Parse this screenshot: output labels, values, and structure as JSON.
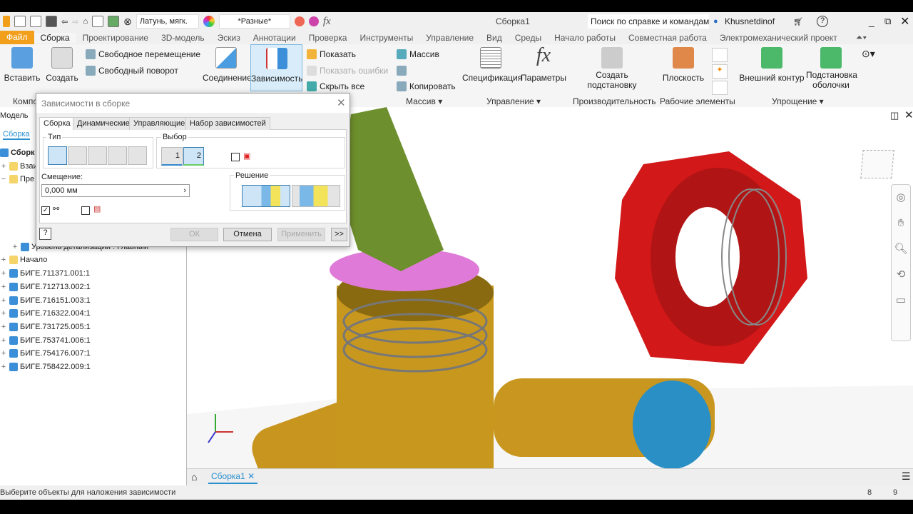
{
  "title_bar": {
    "document": "Сборка1",
    "search_placeholder": "Поиск по справке и командам.",
    "user": "Khusnetdinof",
    "material": "Латунь, мягк.",
    "appearance": "*Разные*",
    "fx": "fx"
  },
  "tabs": [
    "Файл",
    "Сборка",
    "Проектирование",
    "3D-модель",
    "Эскиз",
    "Аннотации",
    "Проверка",
    "Инструменты",
    "Управление",
    "Вид",
    "Среды",
    "Начало работы",
    "Совместная работа",
    "Электромеханический проект"
  ],
  "ribbon": {
    "insert": "Вставить",
    "create": "Создать",
    "group_component": "Компо",
    "free_move": "Свободное перемещение",
    "free_rotate": "Свободный поворот",
    "joint": "Соединение",
    "constraint": "Зависимость",
    "show": "Показать",
    "show_errors": "Показать ошибки",
    "hide_all": "Скрыть все",
    "pattern": "Массив",
    "copy": "Копировать",
    "group_pattern": "Массив ▾",
    "bom": "Спецификация",
    "params": "Параметры",
    "group_manage": "Управление ▾",
    "substitute1": "Создать",
    "substitute2": "подстановку",
    "group_productivity": "Производительность",
    "plane": "Плоскость",
    "group_work": "Рабочие элементы",
    "shrinkwrap": "Внешний контур",
    "shell1": "Подстановка",
    "shell2": "оболочки",
    "group_simplify": "Упрощение ▾"
  },
  "browser": {
    "tab_model": "Модель",
    "tab_assembly": "Сборка",
    "root": "Сборк",
    "items": [
      "Взаи",
      "Пре",
      "Уровень детализации : Главный",
      "Начало",
      "БИГЕ.711371.001:1",
      "БИГЕ.712713.002:1",
      "БИГЕ.716151.003:1",
      "БИГЕ.716322.004:1",
      "БИГЕ.731725.005:1",
      "БИГЕ.753741.006:1",
      "БИГЕ.754176.007:1",
      "БИГЕ.758422.009:1"
    ]
  },
  "dialog": {
    "title": "Зависимости в сборке",
    "tabs": [
      "Сборка",
      "Динамические",
      "Управляющие",
      "Набор зависимостей"
    ],
    "type_label": "Тип",
    "selection_label": "Выбор",
    "sel1": "1",
    "sel2": "2",
    "offset_label": "Смещение:",
    "offset_value": "0,000 мм",
    "solution_label": "Решение",
    "ok": "ОК",
    "cancel": "Отмена",
    "apply": "Применить",
    "more": ">>",
    "help": "?"
  },
  "doc_tab": "Сборка1",
  "status": {
    "message": "Выберите объекты для наложения зависимости",
    "n1": "8",
    "n2": "9"
  }
}
